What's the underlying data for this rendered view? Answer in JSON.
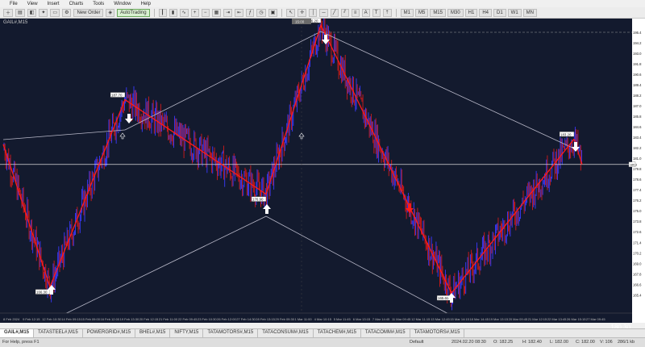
{
  "menu": [
    "File",
    "View",
    "Insert",
    "Charts",
    "Tools",
    "Window",
    "Help"
  ],
  "toolbar": {
    "new_order": "New Order",
    "auto_trading": "AutoTrading",
    "timeframes": [
      "M1",
      "M5",
      "M15",
      "M30",
      "H1",
      "H4",
      "D1",
      "W1",
      "MN"
    ]
  },
  "chart": {
    "symbol_title": "GAIL#,M15",
    "price_labels": [
      "195.4",
      "194.2",
      "193.0",
      "191.8",
      "190.6",
      "189.4",
      "188.2",
      "187.0",
      "185.8",
      "184.6",
      "183.4",
      "182.2",
      "181.0",
      "179.8",
      "178.6",
      "177.4",
      "176.2",
      "175.0",
      "173.8",
      "172.6",
      "171.4",
      "170.2",
      "169.0",
      "167.8",
      "166.6",
      "165.4"
    ],
    "date_labels": [
      "8 Feb 2024",
      "9 Feb 12:15",
      "12 Feb 10:30",
      "14 Feb 09:15",
      "15 Feb 09:00",
      "16 Feb 12:00",
      "19 Feb 13:30",
      "20 Feb 12:15",
      "21 Feb 11:00",
      "22 Feb 09:45",
      "23 Feb 10:30",
      "26 Feb 12:00",
      "27 Feb 14:30",
      "28 Feb 13:15",
      "29 Feb 09:30",
      "1 Mar 11:00",
      "4 Mar 10:15",
      "5 Mar 11:45",
      "6 Mar 13:15",
      "7 Mar 14:45",
      "11 Mar 09:45",
      "12 Mar 11:15",
      "13 Mar 12:45",
      "15 Mar 14:15",
      "18 Mar 14:45",
      "19 Mar 13:15",
      "20 Mar 09:45",
      "21 Mar 12:15",
      "22 Mar 13:45",
      "26 Mar 15:15",
      "27 Mar 09:45"
    ],
    "zigzag_labels": [
      "166.30",
      "187.70",
      "176.90",
      "196.20",
      "165.60",
      "183.20"
    ],
    "top_label": "15:00",
    "hline_label": "180.3",
    "last_price": "180.30"
  },
  "tabs": [
    "GAIL#,M15",
    "TATASTEEL#,M15",
    "POWERGRID#,M15",
    "BHEL#,M15",
    "NIFTY,M15",
    "TATAMOTORS#,M15",
    "TATACONSUM#,M15",
    "TATACHEM#,M15",
    "TATACOMM#,M15",
    "TATAMOTORS#,M15"
  ],
  "status": {
    "help": "For Help, press F1",
    "profile": "Default",
    "datetime": "2024.02.20 08:30",
    "open": "O: 182.25",
    "high": "H: 182.40",
    "low": "L: 182.00",
    "close": "C: 182.00",
    "volume": "V: 106",
    "traffic": "286/1 kb"
  },
  "colors": {
    "chart_bg": "#131a2e",
    "candle_up": "#3a3aff",
    "candle_down": "#d21a1a",
    "zigzag": "#ff1a1a",
    "channel": "#b8b8c8",
    "arrow": "#ffffff"
  }
}
